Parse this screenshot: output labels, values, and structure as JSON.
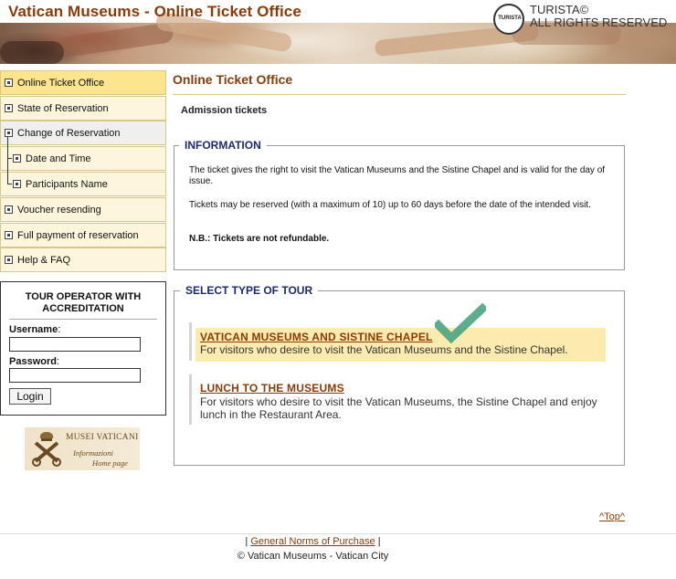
{
  "header": {
    "title": "Vatican Museums - Online Ticket Office",
    "logo_text": "TURISTA",
    "brand_line1": "TURISTA©",
    "brand_line2": "ALL RIGHTS RESERVED"
  },
  "sidebar": {
    "items": [
      {
        "label": "Online Ticket Office"
      },
      {
        "label": "State of Reservation"
      },
      {
        "label": "Change of Reservation"
      },
      {
        "label": "Date and Time"
      },
      {
        "label": "Participants Name"
      },
      {
        "label": "Voucher resending"
      },
      {
        "label": "Full payment of reservation"
      },
      {
        "label": "Help & FAQ"
      }
    ],
    "tour_operator": {
      "title": "TOUR OPERATOR WITH ACCREDITATION",
      "username_label": "Username",
      "password_label": "Password",
      "username_value": "",
      "password_value": "",
      "login_label": "Login"
    },
    "musei_banner": {
      "line1": "MUSEI VATICANI",
      "line2": "Informazioni",
      "line3": "Home page"
    }
  },
  "main": {
    "title": "Online Ticket Office",
    "subtitle": "Admission tickets",
    "information": {
      "legend": "INFORMATION",
      "p1": "The ticket gives the right to visit the Vatican Museums and the Sistine Chapel and is valid for the day of issue.",
      "p2": "Tickets may be reserved (with a maximum of 10) up to 60 days before the date of the intended visit.",
      "p3": "N.B.: Tickets are not refundable."
    },
    "tours": {
      "legend": "SELECT TYPE OF TOUR",
      "items": [
        {
          "name": "VATICAN MUSEUMS AND SISTINE CHAPEL",
          "desc": "For visitors who desire to visit the Vatican Museums and the Sistine Chapel."
        },
        {
          "name": "LUNCH TO THE MUSEUMS",
          "desc": "For visitors who desire to visit the Vatican Museums, the Sistine Chapel and enjoy lunch in the Restaurant Area."
        }
      ]
    }
  },
  "footer": {
    "top_link": "^Top^",
    "sep_left": "| ",
    "norms_link": "General Norms of Purchase",
    "sep_right": " |",
    "copyright": "© Vatican Museums - Vatican City"
  },
  "colors": {
    "brand": "#8a3b07",
    "legend": "#1c2a6b",
    "active_nav": "#fce58c",
    "nav_bg": "#fdf6dc",
    "highlight": "#fcebaf",
    "checkmark": "#4aa382"
  },
  "icons": [
    "turista-logo-icon",
    "nav-square-icon",
    "checkmark-icon",
    "vatican-crest-icon"
  ]
}
